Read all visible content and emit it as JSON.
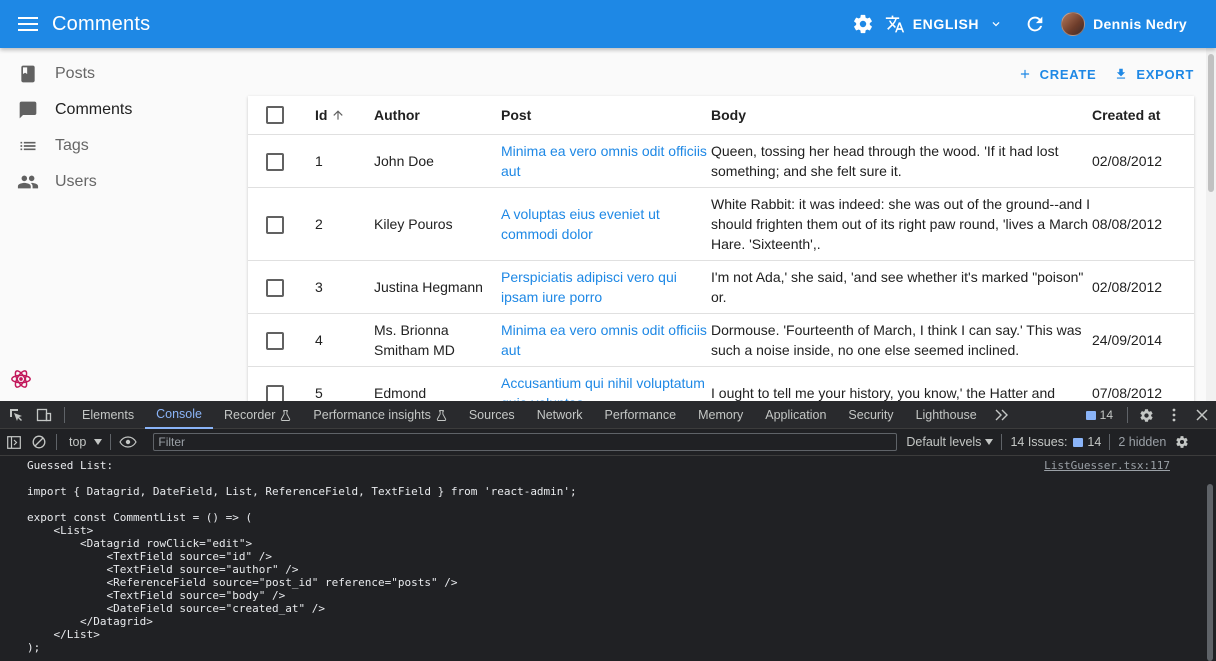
{
  "appbar": {
    "title": "Comments",
    "language": "ENGLISH",
    "user_name": "Dennis Nedry"
  },
  "sidebar": {
    "items": [
      {
        "label": "Posts",
        "icon": "book-icon"
      },
      {
        "label": "Comments",
        "icon": "chat-bubble-icon"
      },
      {
        "label": "Tags",
        "icon": "list-icon"
      },
      {
        "label": "Users",
        "icon": "people-icon"
      }
    ]
  },
  "toolbar": {
    "create_label": "CREATE",
    "export_label": "EXPORT"
  },
  "grid": {
    "headers": {
      "id": "Id",
      "author": "Author",
      "post": "Post",
      "body": "Body",
      "created_at": "Created at"
    },
    "rows": [
      {
        "id": "1",
        "author": "John Doe",
        "post": "Minima ea vero omnis odit officiis aut",
        "body": "Queen, tossing her head through the wood. 'If it had lost something; and she felt sure it.",
        "created_at": "02/08/2012"
      },
      {
        "id": "2",
        "author": "Kiley Pouros",
        "post": "A voluptas eius eveniet ut commodi dolor",
        "body": "White Rabbit: it was indeed: she was out of the ground--and I should frighten them out of its right paw round, 'lives a March Hare. 'Sixteenth',.",
        "created_at": "08/08/2012"
      },
      {
        "id": "3",
        "author": "Justina Hegmann",
        "post": "Perspiciatis adipisci vero qui ipsam iure porro",
        "body": "I'm not Ada,' she said, 'and see whether it's marked \"poison\" or.",
        "created_at": "02/08/2012"
      },
      {
        "id": "4",
        "author": "Ms. Brionna Smitham MD",
        "post": "Minima ea vero omnis odit officiis aut",
        "body": "Dormouse. 'Fourteenth of March, I think I can say.' This was such a noise inside, no one else seemed inclined.",
        "created_at": "24/09/2014"
      },
      {
        "id": "5",
        "author": "Edmond",
        "post": "Accusantium qui nihil voluptatum quia voluptas",
        "body": "I ought to tell me your history, you know,' the Hatter and",
        "created_at": "07/08/2012"
      }
    ]
  },
  "devtools": {
    "tabs": [
      "Elements",
      "Console",
      "Recorder",
      "Performance insights",
      "Sources",
      "Network",
      "Performance",
      "Memory",
      "Application",
      "Security",
      "Lighthouse"
    ],
    "active_tab": "Console",
    "issues_badge": "14",
    "context": "top",
    "filter_placeholder": "Filter",
    "levels": "Default levels",
    "issues_label": "14 Issues:",
    "issues_count": "14",
    "hidden": "2 hidden",
    "source_link": "ListGuesser.tsx:117",
    "console_text": "Guessed List:\n\nimport { Datagrid, DateField, List, ReferenceField, TextField } from 'react-admin';\n\nexport const CommentList = () => (\n    <List>\n        <Datagrid rowClick=\"edit\">\n            <TextField source=\"id\" />\n            <TextField source=\"author\" />\n            <ReferenceField source=\"post_id\" reference=\"posts\" />\n            <TextField source=\"body\" />\n            <DateField source=\"created_at\" />\n        </Datagrid>\n    </List>\n);"
  }
}
